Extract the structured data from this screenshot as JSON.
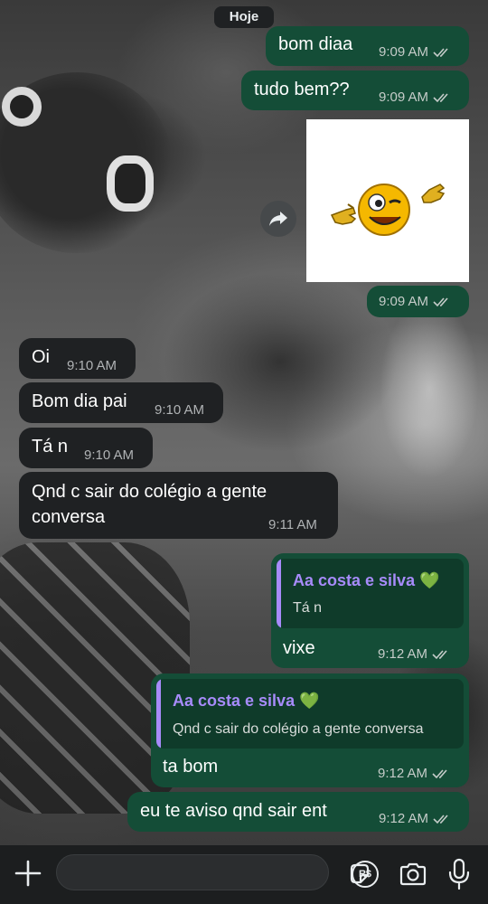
{
  "date_chip": "Hoje",
  "messages": [
    {
      "text": "bom diaa",
      "time": "9:09 AM",
      "direction": "out"
    },
    {
      "text": "tudo bem??",
      "time": "9:09 AM",
      "direction": "out"
    },
    {
      "sticker": "winking-smiley-pointing",
      "time": "9:09 AM",
      "direction": "out"
    },
    {
      "text": "Oi",
      "time": "9:10 AM",
      "direction": "in"
    },
    {
      "text": "Bom dia pai",
      "time": "9:10 AM",
      "direction": "in"
    },
    {
      "text": "Tá n",
      "time": "9:10 AM",
      "direction": "in"
    },
    {
      "text": "Qnd c sair do colégio a gente conversa",
      "time": "9:11 AM",
      "direction": "in"
    },
    {
      "quote_name": "Aa costa e silva 💚",
      "quote_text": "Tá n",
      "text": "vixe",
      "time": "9:12 AM",
      "direction": "out"
    },
    {
      "quote_name": "Aa costa e silva 💚",
      "quote_text": "Qnd c sair do colégio a gente conversa",
      "text": "ta bom",
      "time": "9:12 AM",
      "direction": "out"
    },
    {
      "text": "eu te aviso qnd sair ent",
      "time": "9:12 AM",
      "direction": "out"
    }
  ],
  "composer": {
    "placeholder": ""
  },
  "icons": {
    "forward": "forward-icon",
    "plus": "plus-icon",
    "sticker": "sticker-icon",
    "payment": "payment-icon",
    "camera": "camera-icon",
    "mic": "mic-icon",
    "payment_label": "R$"
  },
  "colors": {
    "outgoing_bubble": "#144d37",
    "incoming_bubble": "#1f2123",
    "quote_name": "#a78bfa",
    "read_tick": "#c5ccc9"
  }
}
